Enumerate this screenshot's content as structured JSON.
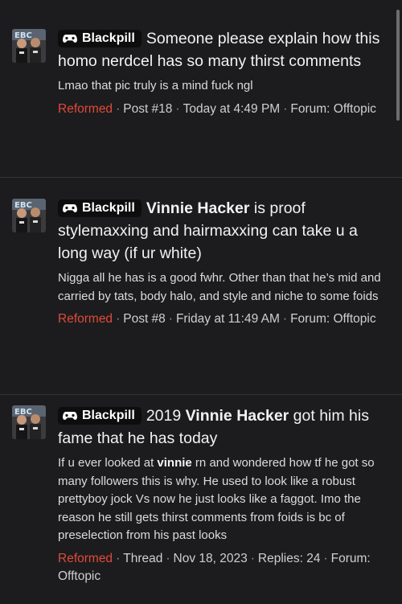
{
  "colors": {
    "background": "#1c1c1e",
    "text": "#e6e6e6",
    "role_red": "#e04a3a",
    "prefix_bg": "#0d0d0d",
    "divider": "#343436"
  },
  "results": [
    {
      "prefix": "Blackpill",
      "prefix_icon": "controller-icon",
      "title_before": "Someone please explain how this homo nerdcel has so many thirst comments",
      "title_bold": "",
      "title_after": "",
      "snippet_before": "Lmao that pic truly is a mind fuck ngl",
      "snippet_bold": "",
      "snippet_after": "",
      "role": "Reformed",
      "meta_type": "Post #18",
      "meta_date": "Today at 4:49 PM",
      "meta_extra": "",
      "meta_forum": "Forum: Offtopic"
    },
    {
      "prefix": "Blackpill",
      "prefix_icon": "controller-icon",
      "title_before": "",
      "title_bold": "Vinnie Hacker",
      "title_after": " is proof stylemaxxing and hairmaxxing can take u a long way (if ur white)",
      "snippet_before": "Nigga all he has is a good fwhr. Other than that he’s mid and carried by tats, body halo, and style and niche to some foids",
      "snippet_bold": "",
      "snippet_after": "",
      "role": "Reformed",
      "meta_type": "Post #8",
      "meta_date": "Friday at 11:49 AM",
      "meta_extra": "",
      "meta_forum": "Forum: Offtopic"
    },
    {
      "prefix": "Blackpill",
      "prefix_icon": "controller-icon",
      "title_before": "2019 ",
      "title_bold": "Vinnie Hacker",
      "title_after": " got him his fame that he has today",
      "snippet_before": "If u ever looked at ",
      "snippet_bold": "vinnie",
      "snippet_after": " rn and wondered how tf he got so many followers this is why. He used to look like a robust prettyboy jock Vs now he just looks like a faggot. Imo the reason he still gets thirst comments from foids is bc of preselection from his past looks",
      "role": "Reformed",
      "meta_type": "Thread",
      "meta_date": "Nov 18, 2023",
      "meta_extra": "Replies: 24",
      "meta_forum": "Forum: Offtopic"
    }
  ]
}
